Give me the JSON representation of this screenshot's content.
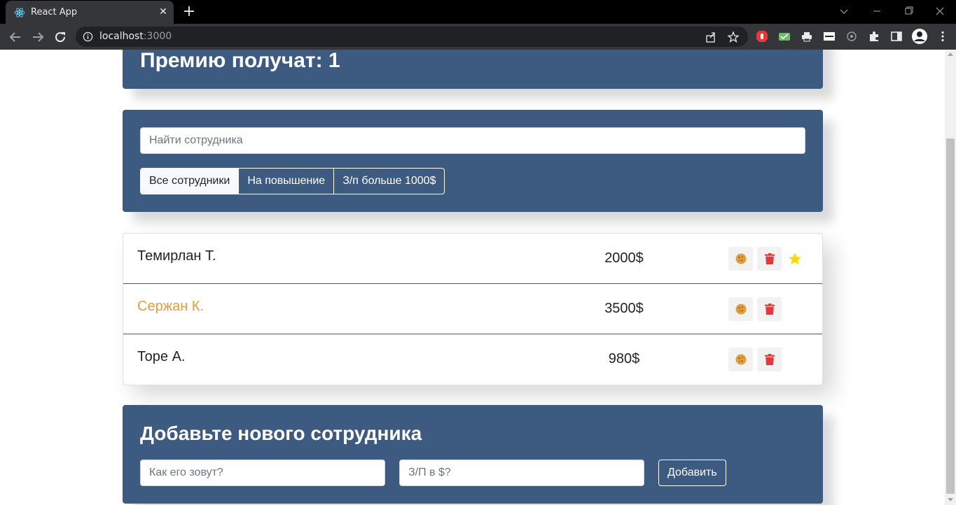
{
  "browser": {
    "tab_title": "React App",
    "tab_close": "✕",
    "new_tab": "+",
    "url_host": "localhost",
    "url_port": ":3000"
  },
  "app": {
    "info": {
      "bonus_line": "Премию получат: 1"
    },
    "search": {
      "placeholder": "Найти сотрудника"
    },
    "filters": [
      {
        "label": "Все сотрудники",
        "active": true
      },
      {
        "label": "На повышение",
        "active": false
      },
      {
        "label": "З/п больше 1000$",
        "active": false
      }
    ],
    "employees": [
      {
        "name": "Темирлан Т.",
        "salary": "2000$",
        "increase": false,
        "rise": true
      },
      {
        "name": "Сержан К.",
        "salary": "3500$",
        "increase": true,
        "rise": false
      },
      {
        "name": "Торе А.",
        "salary": "980$",
        "increase": false,
        "rise": false
      }
    ],
    "add_form": {
      "title": "Добавьте нового сотрудника",
      "name_placeholder": "Как его зовут?",
      "salary_placeholder": "З/П в $?",
      "submit_label": "Добавить"
    }
  },
  "colors": {
    "panel": "#3d5a80",
    "increase_name": "#e09f3e",
    "cookie": "#e09f3e",
    "trash": "#e5383b",
    "star": "#ffd700"
  },
  "icons": [
    "react-favicon",
    "back-arrow-icon",
    "forward-arrow-icon",
    "reload-icon",
    "info-icon",
    "share-icon",
    "bookmark-star-icon",
    "extensions-puzzle-icon",
    "side-panel-icon",
    "profile-avatar-icon",
    "cookie-icon",
    "trash-icon",
    "star-icon"
  ]
}
